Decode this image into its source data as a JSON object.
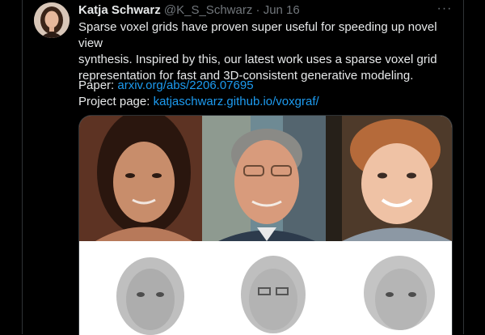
{
  "tweet": {
    "author_name": "Katja Schwarz",
    "handle": "@K_S_Schwarz",
    "separator": "·",
    "date": "Jun 16",
    "more_label": "···",
    "text_line1": "Sparse voxel grids have proven super useful for speeding up novel view",
    "text_line2": "synthesis. Inspired by this, our latest work uses a sparse voxel grid",
    "text_line3": "representation for fast and 3D-consistent generative modeling.",
    "paper_label": "Paper: ",
    "paper_link": "arxiv.org/abs/2206.07695",
    "project_label": "Project page: ",
    "project_link": "katjaschwarz.github.io/voxgraf/"
  },
  "colors": {
    "background": "#000000",
    "text": "#e7e9ea",
    "secondary": "#71767b",
    "link": "#1d9bf0",
    "border": "#2f3336"
  },
  "icons": [
    "avatar-image",
    "more-icon"
  ]
}
